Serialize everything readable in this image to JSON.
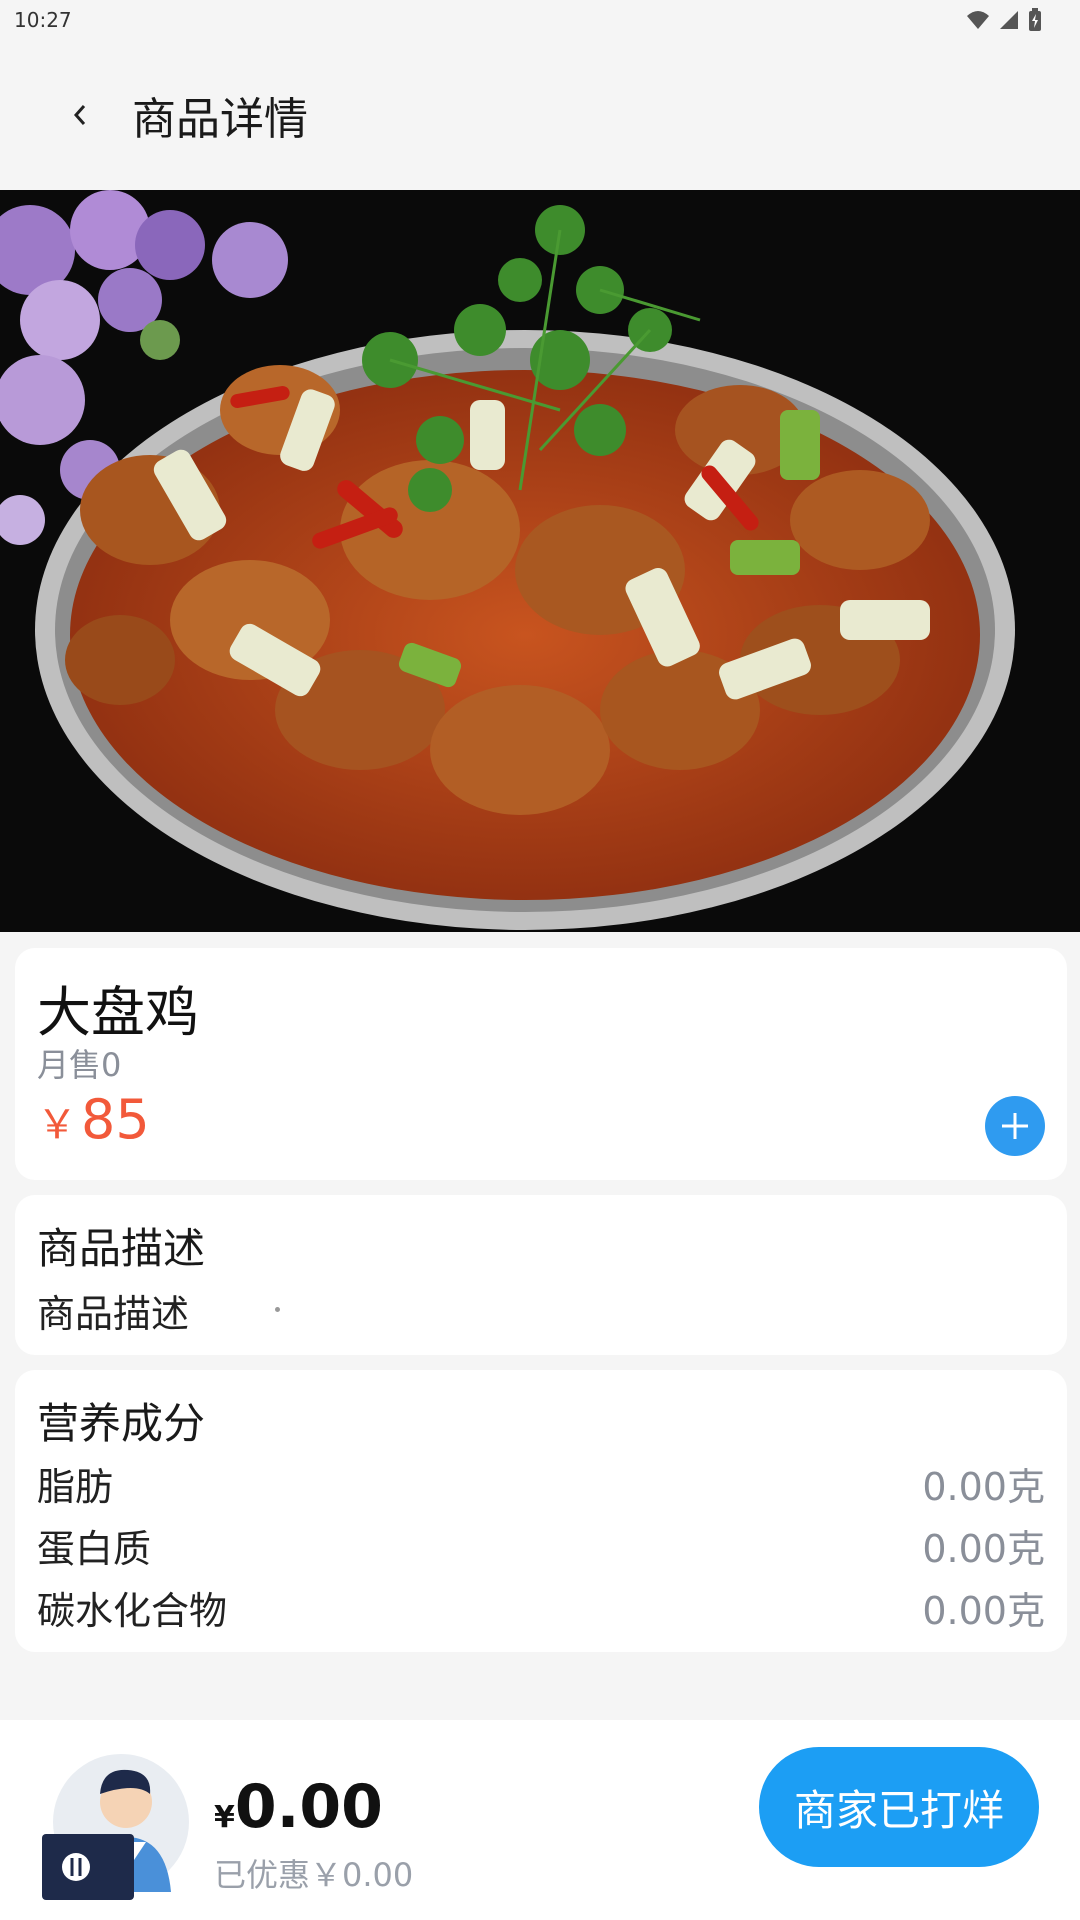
{
  "status_bar": {
    "time": "10:27",
    "icons": [
      "wifi-icon",
      "signal-icon",
      "battery-icon"
    ]
  },
  "header": {
    "back_icon": "chevron-left-icon",
    "title": "商品详情"
  },
  "product": {
    "image": "braised-chicken-dish-photo",
    "name": "大盘鸡",
    "monthly_sales": "月售0",
    "currency": "￥",
    "price": "85",
    "add_icon": "plus-icon"
  },
  "description": {
    "title": "商品描述",
    "text": "商品描述"
  },
  "nutrition": {
    "title": "营养成分",
    "items": [
      {
        "label": "脂肪",
        "value": "0.00克"
      },
      {
        "label": "蛋白质",
        "value": "0.00克"
      },
      {
        "label": "碳水化合物",
        "value": "0.00克"
      }
    ]
  },
  "cart": {
    "avatar_icon": "merchant-avatar",
    "currency": "¥",
    "total": "0.00",
    "discount": "已优惠￥0.00",
    "button_label": "商家已打烊"
  },
  "colors": {
    "accent": "#1c9ef4",
    "price": "#f2593a",
    "muted": "#8a8f99"
  }
}
